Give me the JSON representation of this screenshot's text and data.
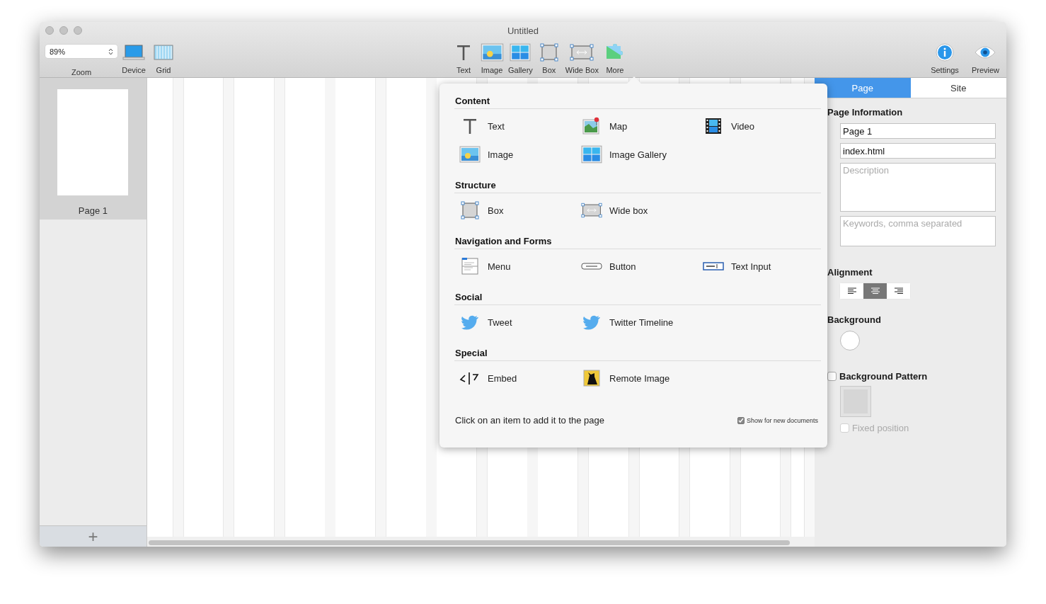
{
  "window": {
    "title": "Untitled"
  },
  "toolbar": {
    "zoom": {
      "value": "89%",
      "label": "Zoom"
    },
    "left_tools": [
      {
        "label": "Device",
        "kind": "device"
      },
      {
        "label": "Grid",
        "kind": "grid"
      }
    ],
    "insert_tools": [
      {
        "label": "Text",
        "kind": "text"
      },
      {
        "label": "Image",
        "kind": "image"
      },
      {
        "label": "Gallery",
        "kind": "gallery"
      },
      {
        "label": "Box",
        "kind": "box"
      },
      {
        "label": "Wide Box",
        "kind": "widebox"
      },
      {
        "label": "More",
        "kind": "more"
      }
    ],
    "right_tools": [
      {
        "label": "Settings",
        "kind": "settings"
      },
      {
        "label": "Preview",
        "kind": "preview"
      }
    ]
  },
  "pages": [
    {
      "label": "Page 1",
      "selected": true
    }
  ],
  "add_page_button": "+",
  "insert_popover": {
    "sections": [
      {
        "title": "Content",
        "items": [
          {
            "label": "Text",
            "kind": "text"
          },
          {
            "label": "Map",
            "kind": "map"
          },
          {
            "label": "Video",
            "kind": "video"
          },
          {
            "label": "Image",
            "kind": "image"
          },
          {
            "label": "Image Gallery",
            "kind": "gallery"
          }
        ]
      },
      {
        "title": "Structure",
        "items": [
          {
            "label": "Box",
            "kind": "box"
          },
          {
            "label": "Wide box",
            "kind": "widebox"
          }
        ]
      },
      {
        "title": "Navigation and Forms",
        "items": [
          {
            "label": "Menu",
            "kind": "menu"
          },
          {
            "label": "Button",
            "kind": "button"
          },
          {
            "label": "Text Input",
            "kind": "textinput"
          }
        ]
      },
      {
        "title": "Social",
        "items": [
          {
            "label": "Tweet",
            "kind": "bird"
          },
          {
            "label": "Twitter Timeline",
            "kind": "bird"
          }
        ]
      },
      {
        "title": "Special",
        "items": [
          {
            "label": "Embed",
            "kind": "embed"
          },
          {
            "label": "Remote Image",
            "kind": "remote"
          }
        ]
      }
    ],
    "hint": "Click on an item to add it to the page",
    "show_for_new": {
      "label": "Show for new documents",
      "checked": true
    }
  },
  "inspector": {
    "tabs": [
      {
        "label": "Page",
        "selected": true
      },
      {
        "label": "Site",
        "selected": false
      }
    ],
    "page_information": {
      "title": "Page Information",
      "fields": [
        {
          "kind": "line",
          "value": "Page 1"
        },
        {
          "kind": "line",
          "value": "index.html"
        },
        {
          "kind": "area",
          "placeholder": "Description"
        },
        {
          "kind": "area_small",
          "placeholder": "Keywords, comma separated"
        }
      ]
    },
    "alignment": {
      "title": "Alignment",
      "options": [
        {
          "kind": "left",
          "selected": false
        },
        {
          "kind": "center",
          "selected": true
        },
        {
          "kind": "right",
          "selected": false
        }
      ]
    },
    "background": {
      "title": "Background"
    },
    "background_pattern": {
      "label": "Background Pattern",
      "checked": false
    },
    "fixed_position": {
      "label": "Fixed position",
      "checked": false,
      "disabled": true
    }
  }
}
